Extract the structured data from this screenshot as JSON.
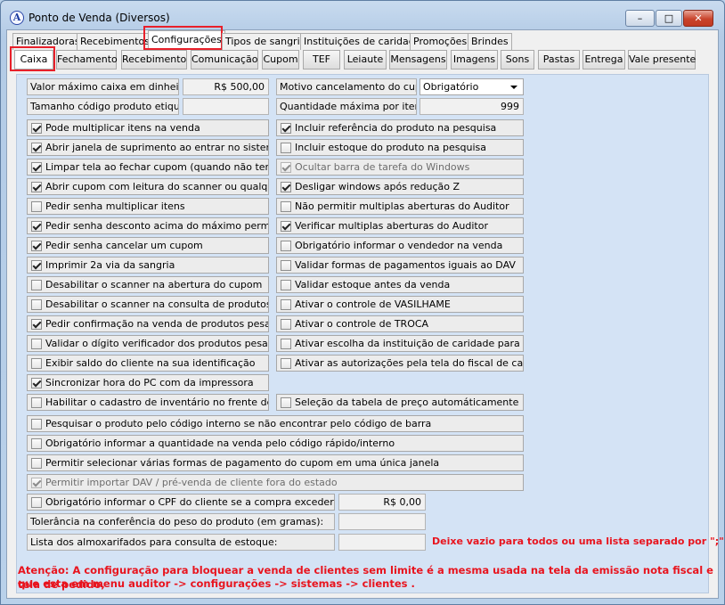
{
  "window": {
    "title": "Ponto de Venda (Diversos)",
    "app_icon": "A",
    "minimize": "–",
    "maximize": "□",
    "close": "✕"
  },
  "top_tabs": [
    "Finalizadoras",
    "Recebimentos",
    "Configurações",
    "Tipos de sangria",
    "Instituições de caridade",
    "Promoções",
    "Brindes"
  ],
  "sub_tabs": [
    "Caixa",
    "Fechamento",
    "Recebimento",
    "Comunicação",
    "Cupom",
    "TEF",
    "Leiaute",
    "Mensagens",
    "Imagens",
    "Sons",
    "Pastas",
    "Entrega",
    "Vale presente"
  ],
  "fields": {
    "max_cash_label": "Valor máximo caixa em dinheiro:",
    "max_cash_value": "R$ 500,00",
    "cancel_reason_label": "Motivo cancelamento do cupom:",
    "cancel_reason_value": "Obrigatório",
    "label_code_size_label": "Tamanho código produto etiqueta:",
    "label_code_size_value": "",
    "max_qty_label": "Quantidade máxima por item:",
    "max_qty_value": "999"
  },
  "left_checks": [
    {
      "label": "Pode multiplicar itens na venda",
      "checked": true
    },
    {
      "label": "Abrir janela de suprimento ao entrar no sistema",
      "checked": true
    },
    {
      "label": "Limpar tela ao fechar cupom (quando não tem troco)",
      "checked": true
    },
    {
      "label": "Abrir cupom com leitura do scanner ou qualquer tecla",
      "checked": true
    },
    {
      "label": "Pedir senha multiplicar itens",
      "checked": false
    },
    {
      "label": "Pedir senha desconto acima do máximo permitido",
      "checked": true
    },
    {
      "label": "Pedir senha cancelar um cupom",
      "checked": true
    },
    {
      "label": "Imprimir 2a via da sangria",
      "checked": true
    },
    {
      "label": "Desabilitar o scanner na abertura do cupom",
      "checked": false
    },
    {
      "label": "Desabilitar o scanner na consulta de produtos",
      "checked": false
    },
    {
      "label": "Pedir confirmação na venda de produtos pesados",
      "checked": true
    },
    {
      "label": "Validar o dígito verificador dos produtos pesados",
      "checked": false
    },
    {
      "label": "Exibir saldo do cliente na sua identificação",
      "checked": false
    },
    {
      "label": "Sincronizar hora do PC com da impressora",
      "checked": true
    },
    {
      "label": "Habilitar o cadastro de inventário no frente de loja",
      "checked": false
    }
  ],
  "right_checks": [
    {
      "label": "Incluir referência do produto na pesquisa",
      "checked": true
    },
    {
      "label": "Incluir estoque do produto na pesquisa",
      "checked": false
    },
    {
      "label": "Ocultar barra de tarefa do Windows",
      "checked": true,
      "disabled": true
    },
    {
      "label": "Desligar windows após redução Z",
      "checked": true
    },
    {
      "label": "Não permitir multiplas aberturas do Auditor",
      "checked": false
    },
    {
      "label": "Verificar multiplas aberturas do Auditor",
      "checked": true
    },
    {
      "label": "Obrigatório informar o vendedor na venda",
      "checked": false
    },
    {
      "label": "Validar formas de pagamentos iguais ao DAV",
      "checked": false
    },
    {
      "label": "Validar estoque antes da venda",
      "checked": false
    },
    {
      "label": "Ativar o controle de VASILHAME",
      "checked": false
    },
    {
      "label": "Ativar o controle de TROCA",
      "checked": false
    },
    {
      "label": "Ativar escolha da instituição de caridade para doação",
      "checked": false
    },
    {
      "label": "Ativar as autorizações pela tela do fiscal  de caixa",
      "checked": false
    },
    null,
    {
      "label": "Seleção da tabela de preço automáticamente",
      "checked": false
    }
  ],
  "wide_checks": [
    {
      "label": "Pesquisar o produto pelo código interno se não encontrar pelo código de barra",
      "checked": false
    },
    {
      "label": "Obrigatório informar a quantidade na venda pelo código rápido/interno",
      "checked": false
    },
    {
      "label": "Permitir selecionar várias formas de pagamento do cupom em uma única janela",
      "checked": false
    },
    {
      "label": "Permitir importar DAV / pré-venda de cliente fora do estado",
      "checked": true,
      "disabled": true
    }
  ],
  "cpf": {
    "label": "Obrigatório informar o CPF do cliente se a compra exceder o valor de",
    "checked": false,
    "value": "R$ 0,00"
  },
  "tolerance_label": "Tolerância na conferência do peso do produto (em gramas):",
  "tolerance_value": "",
  "warehouses_label": "Lista dos almoxarifados para consulta de estoque:",
  "warehouses_value": "",
  "warehouses_hint": "Deixe vazio para todos ou uma lista separado por \";\"",
  "warning_line1": "Atenção: A configuração para bloquear a venda de clientes sem limite é a mesma usada na tela da emissão nota fiscal e tela de pedido,",
  "warning_line2": "que esta em  menu auditor -> configurações -> sistemas -> clientes ."
}
